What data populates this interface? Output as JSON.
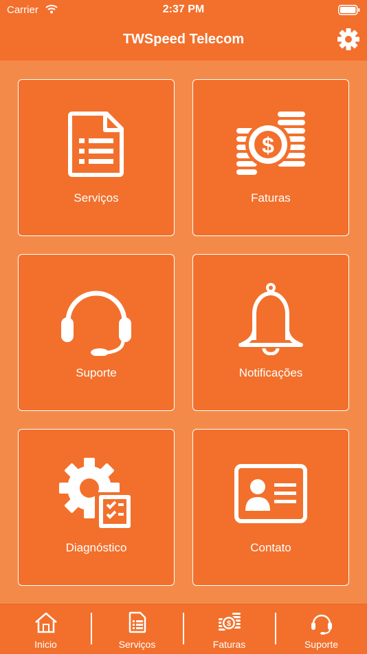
{
  "status": {
    "carrier": "Carrier",
    "time": "2:37 PM"
  },
  "header": {
    "title": "TWSpeed Telecom",
    "settings_icon": "gear-icon"
  },
  "tiles": [
    {
      "label": "Serviços",
      "icon": "document-list-icon"
    },
    {
      "label": "Faturas",
      "icon": "coins-dollar-icon"
    },
    {
      "label": "Suporte",
      "icon": "headset-icon"
    },
    {
      "label": "Notificações",
      "icon": "bell-icon"
    },
    {
      "label": "Diagnóstico",
      "icon": "gear-checklist-icon"
    },
    {
      "label": "Contato",
      "icon": "contact-card-icon"
    }
  ],
  "tabbar": [
    {
      "label": "Inicio",
      "icon": "home-icon"
    },
    {
      "label": "Serviços",
      "icon": "document-list-icon"
    },
    {
      "label": "Faturas",
      "icon": "coins-dollar-icon"
    },
    {
      "label": "Suporte",
      "icon": "headset-icon"
    }
  ],
  "colors": {
    "primary": "#f2702c",
    "background": "#f48a4a",
    "foreground": "#ffffff"
  }
}
